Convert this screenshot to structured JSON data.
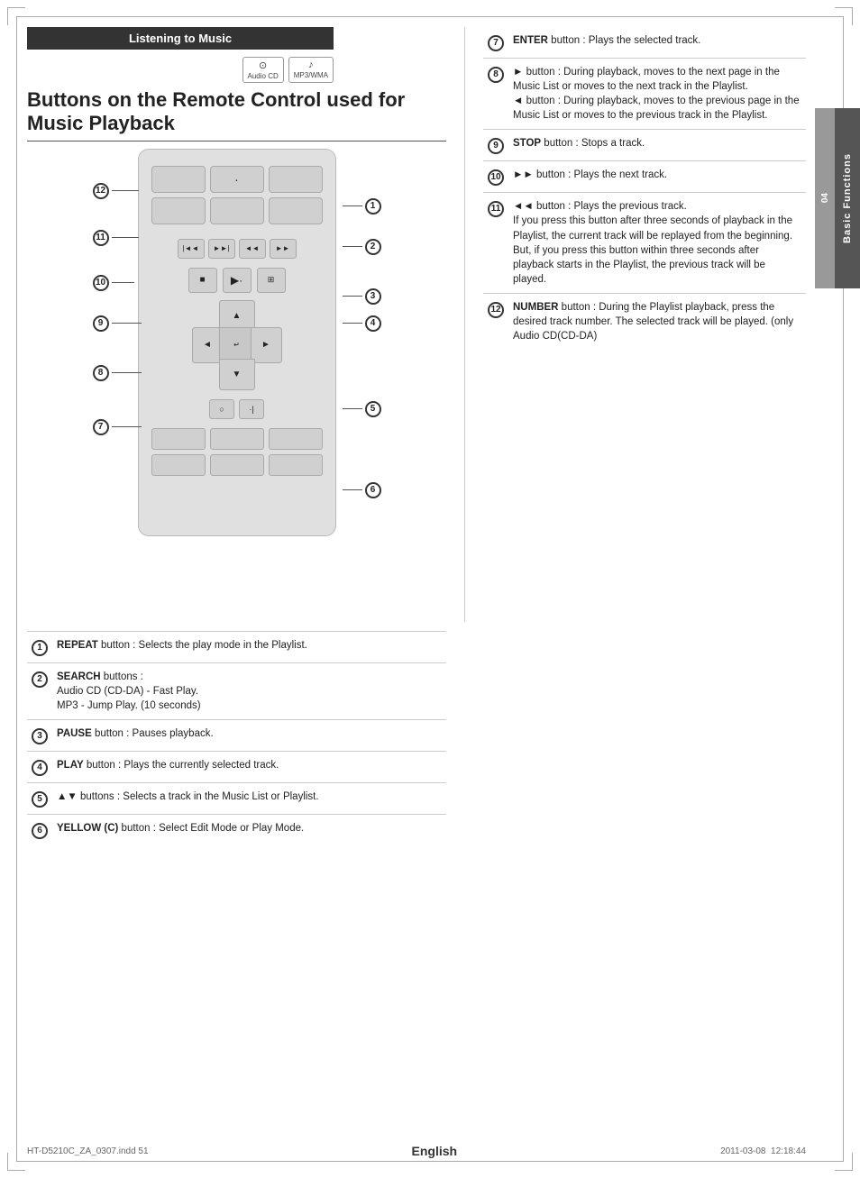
{
  "page": {
    "title": "Listening to Music",
    "subtitle": "Buttons on the Remote Control used for Music Playback",
    "language": "English",
    "footer_file": "HT-D5210C_ZA_0307.indd   51",
    "footer_date": "2011-03-08",
    "footer_time": "12:18:44",
    "chapter": "04",
    "chapter_label": "Basic Functions"
  },
  "icons": [
    {
      "symbol": "⊙",
      "label": "Audio CD"
    },
    {
      "symbol": "♪",
      "label": "MP3/WMA"
    }
  ],
  "callouts": {
    "c1": "1",
    "c2": "2",
    "c3": "3",
    "c4": "4",
    "c5": "5",
    "c6": "6",
    "c7": "7",
    "c8": "8",
    "c9": "9",
    "c10": "10",
    "c11": "11",
    "c12": "12"
  },
  "bottom_items": [
    {
      "num": "1",
      "text_bold": "REPEAT",
      "text_rest": " button : Selects the play mode in the Playlist."
    },
    {
      "num": "2",
      "text_bold": "SEARCH",
      "text_rest": " buttons :\nAudio CD (CD-DA) - Fast Play.\nMP3 - Jump Play. (10 seconds)"
    },
    {
      "num": "3",
      "text_bold": "PAUSE",
      "text_rest": " button : Pauses playback."
    },
    {
      "num": "4",
      "text_bold": "PLAY",
      "text_rest": " button : Plays the currently selected track."
    },
    {
      "num": "5",
      "text_bold": "▲▼",
      "text_rest": " buttons : Selects a track in the Music List or Playlist."
    },
    {
      "num": "6",
      "text_bold": "YELLOW (C)",
      "text_rest": " button : Select Edit Mode or Play Mode."
    }
  ],
  "right_items": [
    {
      "num": "7",
      "text_bold": "ENTER",
      "text_rest": " button : Plays the selected track."
    },
    {
      "num": "8",
      "text_bold": "",
      "text_rest": "► button : During playback, moves to the next page in the Music List or moves to the next track in the Playlist.\n◄ button : During playback, moves to the previous page in the Music List or moves to the previous track in the Playlist."
    },
    {
      "num": "9",
      "text_bold": "STOP",
      "text_rest": " button : Stops a track."
    },
    {
      "num": "10",
      "text_bold": "",
      "text_rest": "►► button : Plays the next track."
    },
    {
      "num": "11",
      "text_bold": "",
      "text_rest": "◄◄ button : Plays the previous track.\nIf you press this button after three seconds of playback in the Playlist, the current track will be replayed from the beginning. But, if you press this button within three seconds after playback starts in the Playlist, the previous track will be played."
    },
    {
      "num": "12",
      "text_bold": "NUMBER",
      "text_rest": " button : During the Playlist playback, press the desired track number. The selected track will be played. (only Audio CD(CD-DA)"
    }
  ]
}
